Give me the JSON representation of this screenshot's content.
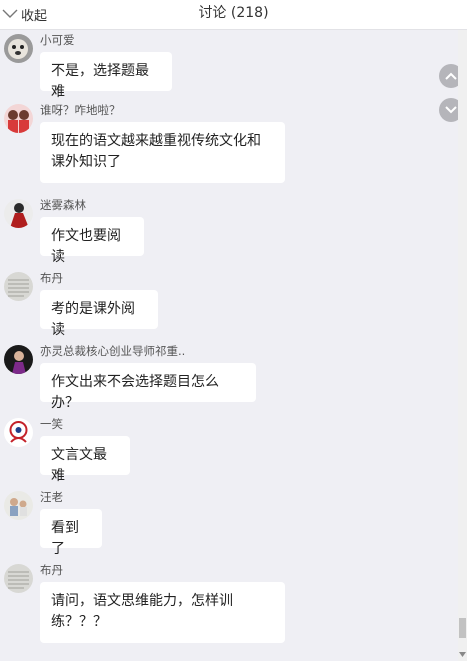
{
  "header": {
    "collapse_label": "收起",
    "title": "讨论 (218)"
  },
  "messages": [
    {
      "name": "小可爱",
      "text": "不是，选择题最难"
    },
    {
      "name": "谁呀？咋地啦？",
      "text": "现在的语文越来越重视传统文化和课外知识了"
    },
    {
      "name": "迷雾森林",
      "text": "作文也要阅读"
    },
    {
      "name": "布丹",
      "text": "考的是课外阅读"
    },
    {
      "name": "亦灵总裁核心创业导师祁重..",
      "text": "作文出来不会选择题目怎么办？"
    },
    {
      "name": "一笑",
      "text": "文言文最难"
    },
    {
      "name": "汪老",
      "text": "看到了"
    },
    {
      "name": "布丹",
      "text": "请问，语文思维能力，怎样训练？？？"
    }
  ],
  "icons": {
    "collapse": "chevron-down-icon",
    "scroll_up": "chevron-up-icon",
    "scroll_down": "chevron-down-icon"
  },
  "colors": {
    "background": "#efeff4",
    "bubble": "#ffffff",
    "nav_button": "#b5b5ba"
  }
}
